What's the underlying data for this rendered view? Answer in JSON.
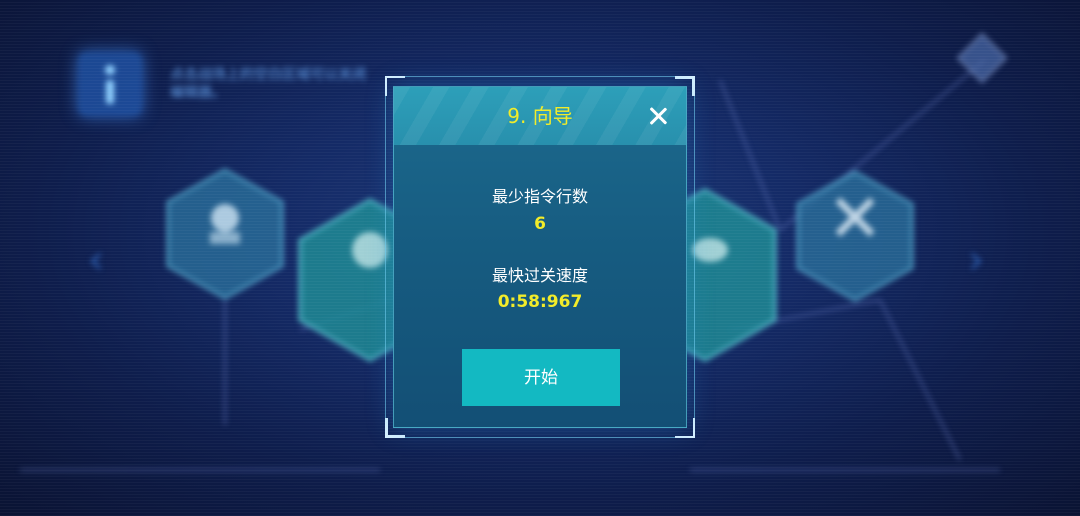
{
  "background": {
    "hint_text": "点击战场上的空白区域可以关闭编辑器。",
    "left_arrow_icon": "chevron-left-icon",
    "right_arrow_icon": "chevron-right-icon",
    "info_icon": "info-icon",
    "top_right_icon": "diamond-icon"
  },
  "dialog": {
    "title": "9. 向导",
    "close_icon": "close-icon",
    "stats": [
      {
        "label": "最少指令行数",
        "value": "6"
      },
      {
        "label": "最快过关速度",
        "value": "0:58:967"
      }
    ],
    "start_label": "开始"
  },
  "colors": {
    "title_yellow": "#f2ec2a",
    "panel_teal": "#1c6a8e",
    "button_cyan": "#13b9c2",
    "background_navy": "#142a66"
  }
}
